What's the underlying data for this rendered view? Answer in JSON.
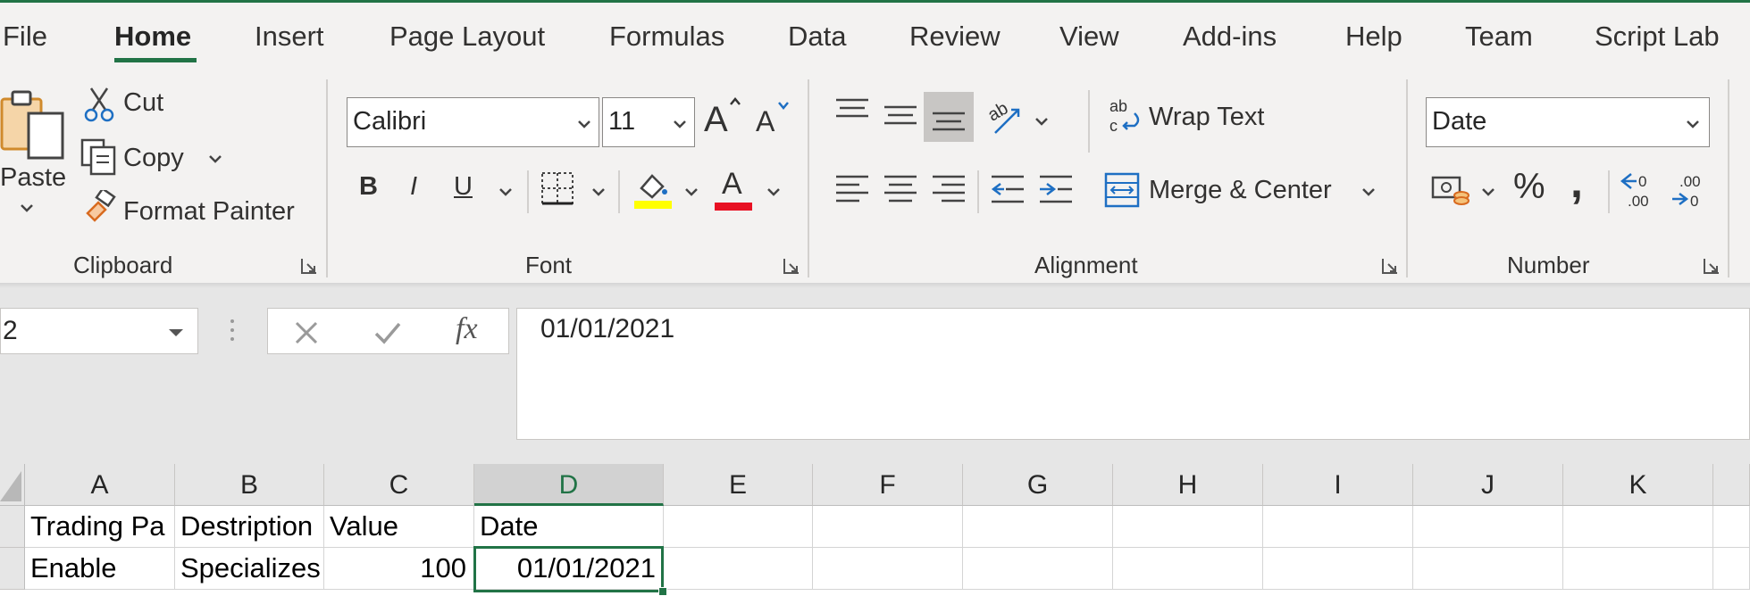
{
  "tabs": [
    {
      "label": "File"
    },
    {
      "label": "Home"
    },
    {
      "label": "Insert"
    },
    {
      "label": "Page Layout"
    },
    {
      "label": "Formulas"
    },
    {
      "label": "Data"
    },
    {
      "label": "Review"
    },
    {
      "label": "View"
    },
    {
      "label": "Add-ins"
    },
    {
      "label": "Help"
    },
    {
      "label": "Team"
    },
    {
      "label": "Script Lab"
    }
  ],
  "clipboard": {
    "paste_label": "Paste",
    "cut_label": "Cut",
    "copy_label": "Copy",
    "format_painter_label": "Format Painter",
    "group_label": "Clipboard"
  },
  "font": {
    "font_name": "Calibri",
    "font_size": "11",
    "bold": "B",
    "italic": "I",
    "underline": "U",
    "font_color_letter": "A",
    "highlight_color": "#ffff00",
    "font_color": "#e81123",
    "group_label": "Font"
  },
  "alignment": {
    "wrap_text_label": "Wrap Text",
    "merge_center_label": "Merge & Center",
    "group_label": "Alignment"
  },
  "number": {
    "format": "Date",
    "percent": "%",
    "comma": ",",
    "group_label": "Number"
  },
  "formula_bar": {
    "name_box": "2",
    "fx": "fx",
    "value": "01/01/2021"
  },
  "sheet": {
    "columns": [
      "A",
      "B",
      "C",
      "D",
      "E",
      "F",
      "G",
      "H",
      "I",
      "J",
      "K"
    ],
    "selected_column": "D",
    "rows": [
      {
        "cells": [
          "Trading Pa",
          "Destription",
          "Value",
          "Date"
        ]
      },
      {
        "cells": [
          "Enable",
          "Specializes",
          "100",
          "01/01/2021"
        ]
      }
    ]
  },
  "colors": {
    "accent": "#217346"
  }
}
